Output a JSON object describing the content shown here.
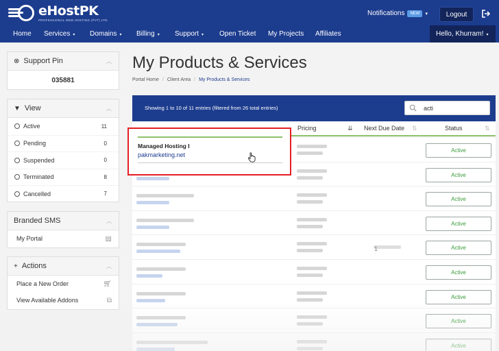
{
  "brand": {
    "name": "eHostPK",
    "tagline": "PROFESSIONAL WEB HOSTING (PVT) LTD."
  },
  "header": {
    "notifications_label": "Notifications",
    "notifications_badge": "NEW",
    "logout_label": "Logout",
    "greeting": "Hello, Khurram!"
  },
  "nav": {
    "items": [
      {
        "label": "Home"
      },
      {
        "label": "Services"
      },
      {
        "label": "Domains"
      },
      {
        "label": "Billing"
      },
      {
        "label": "Support"
      },
      {
        "label": "Open Ticket"
      },
      {
        "label": "My Projects"
      },
      {
        "label": "Affiliates"
      }
    ]
  },
  "sidebar": {
    "support_pin": {
      "title": "Support Pin",
      "value": "035881"
    },
    "view": {
      "title": "View",
      "items": [
        {
          "label": "Active",
          "count": "11"
        },
        {
          "label": "Pending",
          "count": "0"
        },
        {
          "label": "Suspended",
          "count": "0"
        },
        {
          "label": "Terminated",
          "count": "8"
        },
        {
          "label": "Cancelled",
          "count": "7"
        }
      ]
    },
    "branded_sms": {
      "title": "Branded SMS",
      "items": [
        {
          "label": "My Portal",
          "icon": "list-icon"
        }
      ]
    },
    "actions": {
      "title": "Actions",
      "items": [
        {
          "label": "Place a New Order",
          "icon": "cart-icon"
        },
        {
          "label": "View Available Addons",
          "icon": "cubes-icon"
        }
      ]
    }
  },
  "main": {
    "title": "My Products & Services",
    "breadcrumb": [
      "Portal Home",
      "Client Area",
      "My Products & Services"
    ],
    "table_info": "Showing 1 to 10 of 11 entries (filtered from 26 total entries)",
    "search_value": "acti",
    "columns": {
      "pricing": "Pricing",
      "next_due": "Next Due Date",
      "status": "Status"
    },
    "first_row": {
      "product": "Managed Hosting I",
      "domain": "pakmarketing.net"
    },
    "status_labels": [
      "Active",
      "Active",
      "Active",
      "Active",
      "Active",
      "Active",
      "Active",
      "Active",
      "Active"
    ],
    "partial_date": "1"
  },
  "colors": {
    "brand_blue": "#1c3c8e",
    "dark_blue": "#12245a",
    "active_green": "#3a9a3a",
    "highlight_red": "#e51c23"
  }
}
